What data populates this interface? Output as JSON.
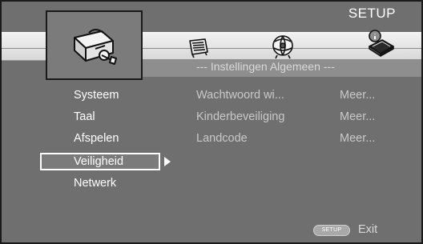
{
  "header": {
    "title": "SETUP"
  },
  "tabs": [
    {
      "icon": "toolbox-icon",
      "selected": true
    },
    {
      "icon": "display-screen-icon",
      "selected": false
    },
    {
      "icon": "speaker-sphere-icon",
      "selected": false
    },
    {
      "icon": "info-book-icon",
      "selected": false
    }
  ],
  "section_title": "--- Instellingen Algemeen ---",
  "menu": {
    "items": [
      {
        "label": "Systeem"
      },
      {
        "label": "Taal"
      },
      {
        "label": "Afspelen"
      },
      {
        "label": "Veiligheid"
      },
      {
        "label": "Netwerk"
      }
    ],
    "active_index": 3
  },
  "options": [
    {
      "label": "Wachtwoord wi...",
      "value": "Meer..."
    },
    {
      "label": "Kinderbeveiliging",
      "value": "Meer..."
    },
    {
      "label": "Landcode",
      "value": "Meer..."
    }
  ],
  "footer": {
    "button_label": "SETUP",
    "action_label": "Exit"
  },
  "colors": {
    "background": "#6f6f6f",
    "band": "#e6e6e6",
    "text": "#ffffff",
    "dim_text": "#c9c9c9"
  }
}
